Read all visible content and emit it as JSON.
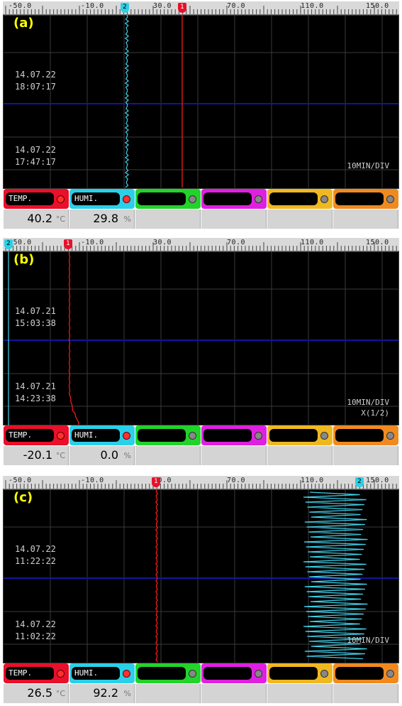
{
  "scale": {
    "labels": [
      "-50.0",
      "-10.0",
      "30.0",
      "70.0",
      "110.0",
      "150.0"
    ]
  },
  "panels": [
    {
      "tag": "(a)",
      "timestamps": [
        {
          "date": "14.07.22",
          "time": "18:07:17"
        },
        {
          "date": "14.07.22",
          "time": "17:47:17"
        }
      ],
      "div_label": "10MIN/DIV",
      "div_sub": "",
      "markers": {
        "red": "1",
        "cyan": "2"
      },
      "temp": {
        "name": "TEMP.",
        "value": "40.2",
        "unit": "°C"
      },
      "humi": {
        "name": "HUMI.",
        "value": "29.8",
        "unit": "%"
      }
    },
    {
      "tag": "(b)",
      "timestamps": [
        {
          "date": "14.07.21",
          "time": "15:03:38"
        },
        {
          "date": "14.07.21",
          "time": "14:23:38"
        }
      ],
      "div_label": "10MIN/DIV",
      "div_sub": "X(1/2)",
      "markers": {
        "red": "1",
        "cyan": "2"
      },
      "temp": {
        "name": "TEMP.",
        "value": "-20.1",
        "unit": "°C"
      },
      "humi": {
        "name": "HUMI.",
        "value": "0.0",
        "unit": "%"
      }
    },
    {
      "tag": "(c)",
      "timestamps": [
        {
          "date": "14.07.22",
          "time": "11:22:22"
        },
        {
          "date": "14.07.22",
          "time": "11:02:22"
        }
      ],
      "div_label": "10MIN/DIV",
      "div_sub": "",
      "markers": {
        "red": "1",
        "cyan": "2"
      },
      "temp": {
        "name": "TEMP.",
        "value": "26.5",
        "unit": "°C"
      },
      "humi": {
        "name": "HUMI.",
        "value": "92.2",
        "unit": "%"
      }
    }
  ],
  "channel_colors": {
    "temp": "#e8102a",
    "humi": "#2ad0e8",
    "ch3": "#22d32a",
    "ch4": "#e020e0",
    "ch5": "#f0b820",
    "ch6": "#f08a20"
  },
  "trace_colors": {
    "temp": "#ff2020",
    "humi": "#40d0e8"
  }
}
